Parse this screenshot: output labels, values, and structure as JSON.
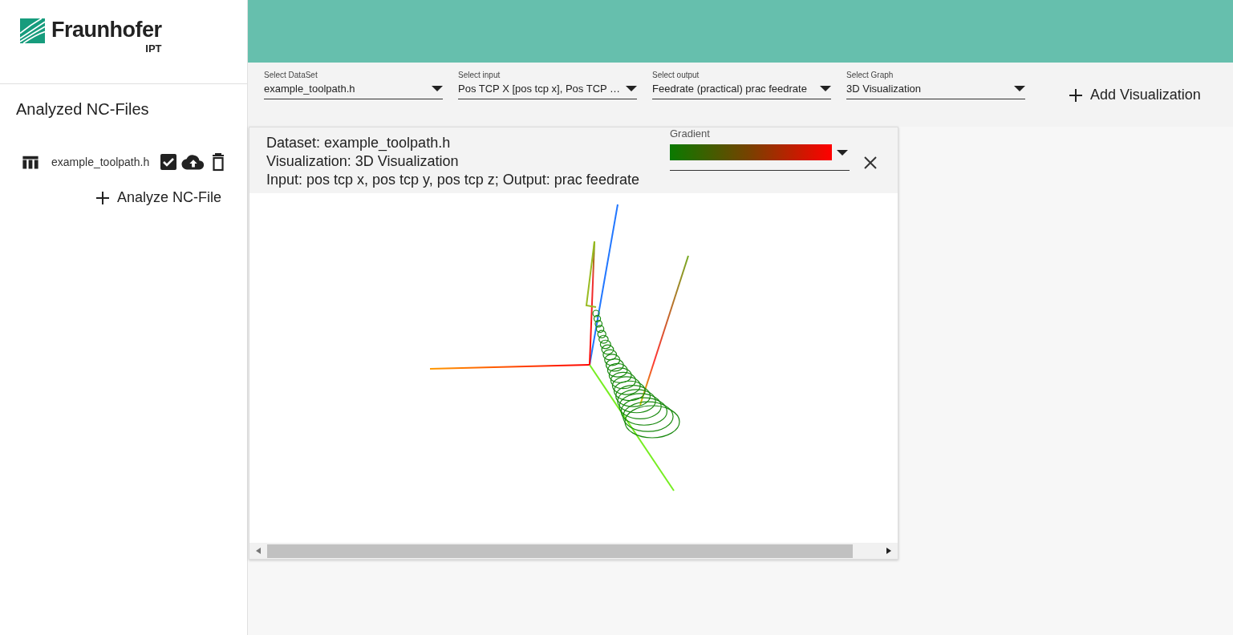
{
  "logo": {
    "name": "Fraunhofer",
    "unit": "IPT"
  },
  "sidebar": {
    "title": "Analyzed NC-Files",
    "files": [
      {
        "name": "example_toolpath.h",
        "checked": true
      }
    ],
    "analyze_button": "Analyze NC-File"
  },
  "toolbar": {
    "selects": [
      {
        "label": "Select DataSet",
        "value": "example_toolpath.h"
      },
      {
        "label": "Select input",
        "value": "Pos TCP X [pos tcp x], Pos TCP …"
      },
      {
        "label": "Select output",
        "value": "Feedrate (practical) prac feedrate"
      },
      {
        "label": "Select Graph",
        "value": "3D Visualization"
      }
    ],
    "add_button": "Add Visualization"
  },
  "card": {
    "lines": [
      "Dataset: example_toolpath.h",
      "Visualization: 3D Visualization",
      "Input: pos tcp x, pos tcp y, pos tcp z; Output: prac feedrate"
    ],
    "gradient_label": "Gradient"
  }
}
